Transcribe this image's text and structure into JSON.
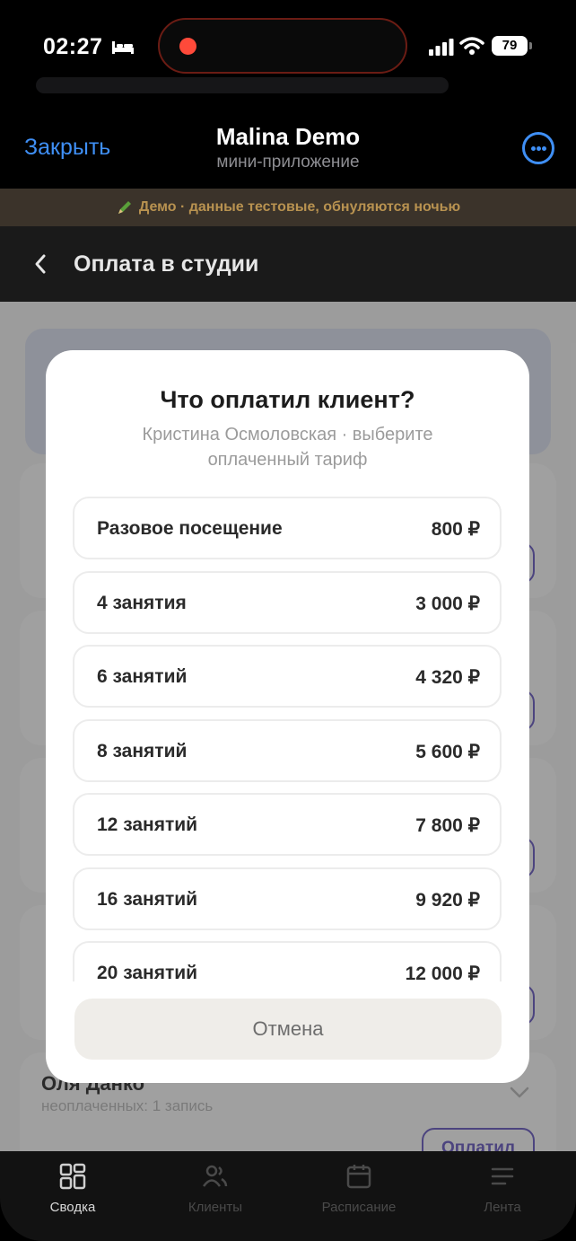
{
  "status_bar": {
    "time": "02:27",
    "battery": "79"
  },
  "telegram_header": {
    "close_label": "Закрыть",
    "title": "Malina Demo",
    "subtitle": "мини-приложение"
  },
  "demo_banner": {
    "text": "Демо · данные тестовые, обнуляются ночью"
  },
  "page": {
    "title": "Оплата в студии"
  },
  "background": {
    "client_name": "Оля Данко",
    "client_sub": "неоплаченных: 1 запись",
    "pay_label": "Оплатил"
  },
  "modal": {
    "title": "Что оплатил клиент?",
    "subtitle": "Кристина Осмоловская · выберите оплаченный тариф",
    "tariffs": [
      {
        "name": "Разовое посещение",
        "price": "800 ₽"
      },
      {
        "name": "4 занятия",
        "price": "3 000 ₽"
      },
      {
        "name": "6 занятий",
        "price": "4 320 ₽"
      },
      {
        "name": "8 занятий",
        "price": "5 600 ₽"
      },
      {
        "name": "12 занятий",
        "price": "7 800 ₽"
      },
      {
        "name": "16 занятий",
        "price": "9 920 ₽"
      },
      {
        "name": "20 занятий",
        "price": "12 000 ₽"
      }
    ],
    "cancel_label": "Отмена"
  },
  "bottom_nav": {
    "items": [
      {
        "label": "Сводка",
        "icon": "dashboard-icon",
        "active": true
      },
      {
        "label": "Клиенты",
        "icon": "clients-icon",
        "active": false
      },
      {
        "label": "Расписание",
        "icon": "calendar-icon",
        "active": false
      },
      {
        "label": "Лента",
        "icon": "feed-icon",
        "active": false
      }
    ]
  },
  "colors": {
    "link_blue": "#3f8ff5",
    "accent_purple": "#6a5fb0",
    "banner_text": "#b89250"
  }
}
